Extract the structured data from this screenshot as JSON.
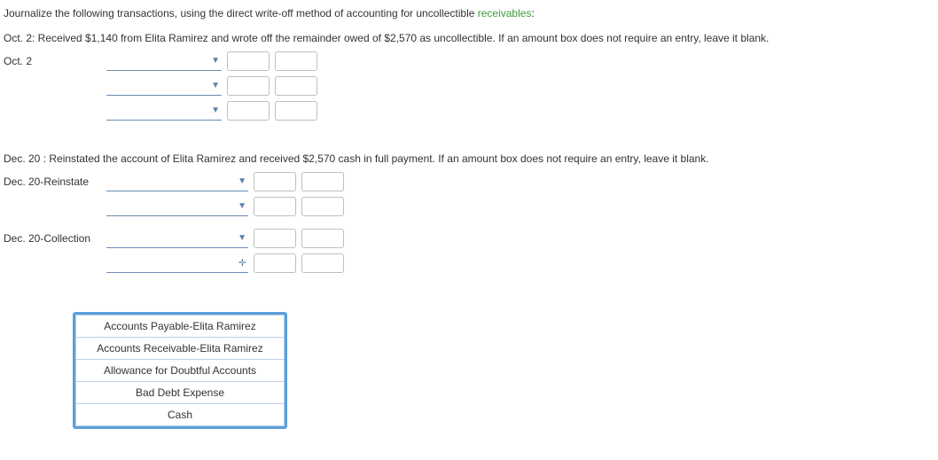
{
  "intro": {
    "prefix": "Journalize the following transactions, using the direct write-off method of accounting for uncollectible ",
    "link": "receivables",
    "suffix": ":"
  },
  "entries": [
    {
      "instruction": "Oct. 2: Received $1,140 from Elita Ramirez and wrote off the remainder owed of $2,570 as uncollectible. If an amount box does not require an entry, leave it blank.",
      "groups": [
        {
          "date": "Oct. 2",
          "acct_width": "w1",
          "rows": [
            {
              "account": "",
              "debit": "",
              "credit": "",
              "caret": "tri"
            },
            {
              "account": "",
              "debit": "",
              "credit": "",
              "caret": "tri"
            },
            {
              "account": "",
              "debit": "",
              "credit": "",
              "caret": "tri"
            }
          ]
        }
      ]
    },
    {
      "instruction": "Dec. 20 : Reinstated the account of Elita Ramirez and received $2,570 cash in full payment. If an amount box does not require an entry, leave it blank.",
      "groups": [
        {
          "date": "Dec. 20-Reinstate",
          "acct_width": "w2",
          "rows": [
            {
              "account": "",
              "debit": "",
              "credit": "",
              "caret": "tri"
            },
            {
              "account": "",
              "debit": "",
              "credit": "",
              "caret": "tri"
            }
          ]
        },
        {
          "date": "Dec. 20-Collection",
          "acct_width": "w2",
          "rows": [
            {
              "account": "",
              "debit": "",
              "credit": "",
              "caret": "tri"
            },
            {
              "account": "",
              "debit": "",
              "credit": "",
              "caret": "tri-add"
            }
          ]
        }
      ]
    }
  ],
  "dropdown": {
    "options": [
      "Accounts Payable-Elita Ramirez",
      "Accounts Receivable-Elita Ramirez",
      "Allowance for Doubtful Accounts",
      "Bad Debt Expense",
      "Cash"
    ]
  }
}
